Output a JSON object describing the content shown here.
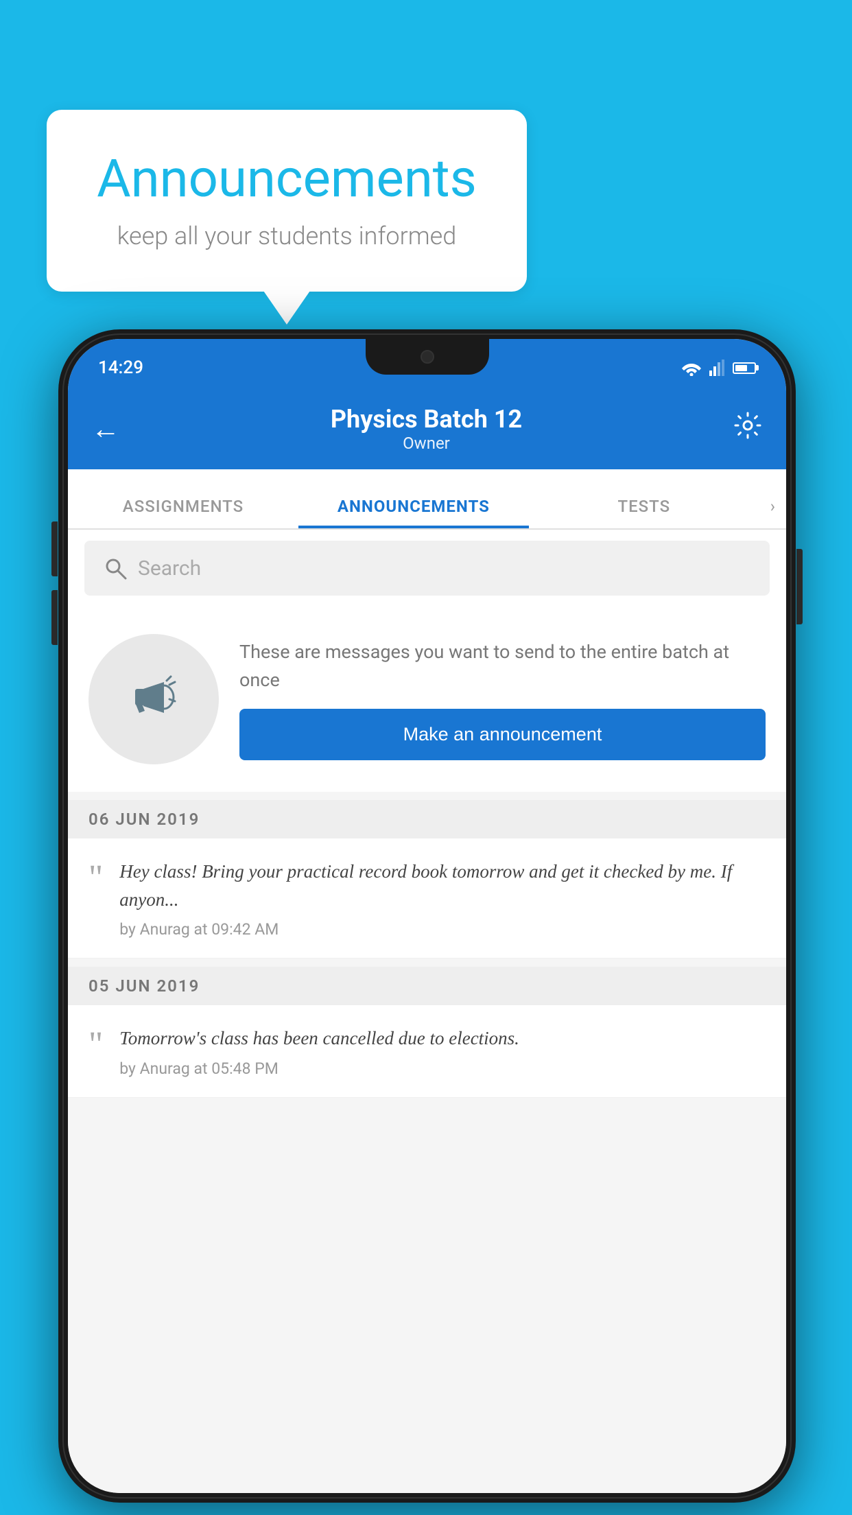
{
  "background": {
    "color": "#1BB8E8"
  },
  "speech_bubble": {
    "title": "Announcements",
    "subtitle": "keep all your students informed"
  },
  "phone": {
    "status_bar": {
      "time": "14:29"
    },
    "app_bar": {
      "back_label": "←",
      "title": "Physics Batch 12",
      "subtitle": "Owner",
      "settings_label": "⚙"
    },
    "tabs": [
      {
        "label": "ASSIGNMENTS",
        "active": false
      },
      {
        "label": "ANNOUNCEMENTS",
        "active": true
      },
      {
        "label": "TESTS",
        "active": false
      }
    ],
    "search": {
      "placeholder": "Search"
    },
    "announcement_prompt": {
      "description": "These are messages you want to send to the entire batch at once",
      "button_label": "Make an announcement"
    },
    "announcements": [
      {
        "date": "06  JUN  2019",
        "message": "Hey class! Bring your practical record book tomorrow and get it checked by me. If anyon...",
        "meta": "by Anurag at 09:42 AM"
      },
      {
        "date": "05  JUN  2019",
        "message": "Tomorrow's class has been cancelled due to elections.",
        "meta": "by Anurag at 05:48 PM"
      }
    ]
  }
}
